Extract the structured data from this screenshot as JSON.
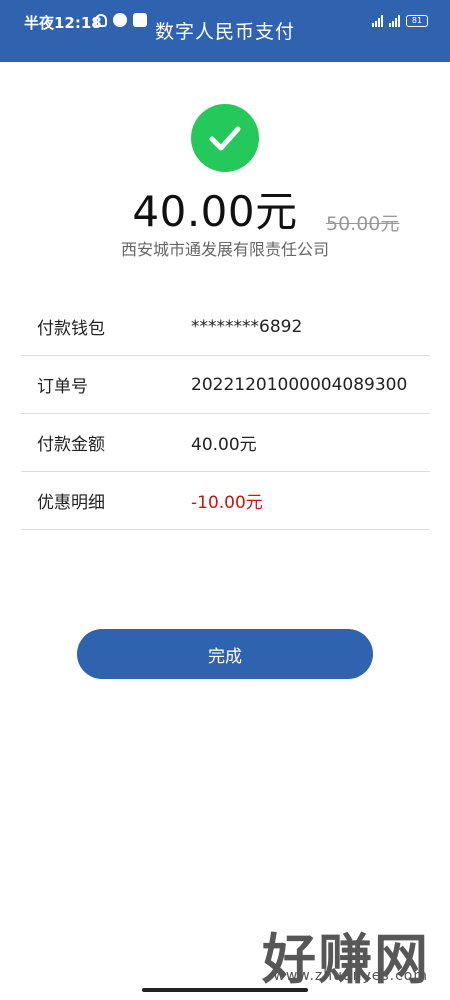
{
  "status_bar": {
    "time": "半夜12:18",
    "battery": "81",
    "network": "4G"
  },
  "header": {
    "title": "数字人民币支付"
  },
  "payment": {
    "amount": "40.00元",
    "original_amount": "50.00元",
    "merchant": "西安城市通发展有限责任公司"
  },
  "details": [
    {
      "label": "付款钱包",
      "value": "********6892"
    },
    {
      "label": "订单号",
      "value": "20221201000004089300"
    },
    {
      "label": "付款金额",
      "value": "40.00元"
    },
    {
      "label": "优惠明细",
      "value": "-10.00元"
    }
  ],
  "actions": {
    "done_label": "完成"
  },
  "watermark": {
    "text": "好赚网",
    "url": "www.zhuanyes.com"
  },
  "colors": {
    "header": "#2f63b0",
    "success": "#25c85a",
    "discount": "#c81414"
  }
}
